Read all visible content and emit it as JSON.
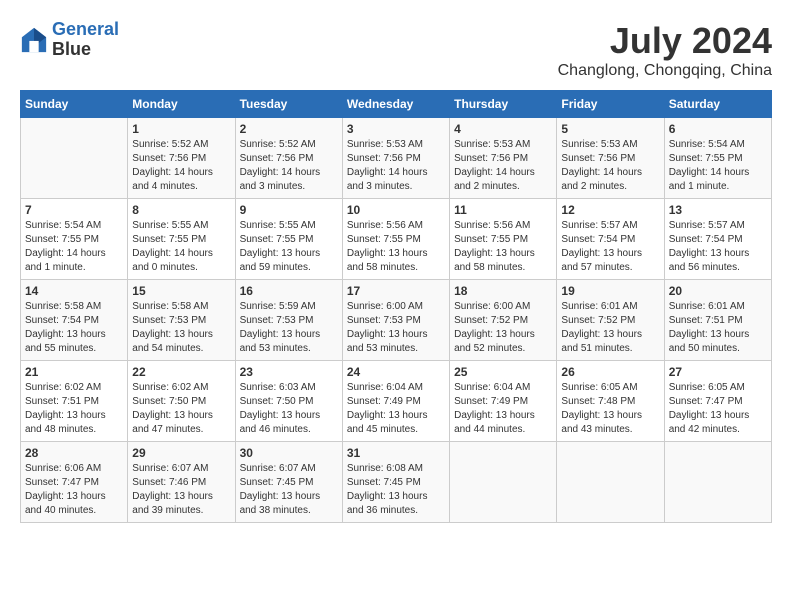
{
  "header": {
    "logo_line1": "General",
    "logo_line2": "Blue",
    "month_year": "July 2024",
    "location": "Changlong, Chongqing, China"
  },
  "weekdays": [
    "Sunday",
    "Monday",
    "Tuesday",
    "Wednesday",
    "Thursday",
    "Friday",
    "Saturday"
  ],
  "weeks": [
    [
      {
        "day": "",
        "sunrise": "",
        "sunset": "",
        "daylight": ""
      },
      {
        "day": "1",
        "sunrise": "Sunrise: 5:52 AM",
        "sunset": "Sunset: 7:56 PM",
        "daylight": "Daylight: 14 hours and 4 minutes."
      },
      {
        "day": "2",
        "sunrise": "Sunrise: 5:52 AM",
        "sunset": "Sunset: 7:56 PM",
        "daylight": "Daylight: 14 hours and 3 minutes."
      },
      {
        "day": "3",
        "sunrise": "Sunrise: 5:53 AM",
        "sunset": "Sunset: 7:56 PM",
        "daylight": "Daylight: 14 hours and 3 minutes."
      },
      {
        "day": "4",
        "sunrise": "Sunrise: 5:53 AM",
        "sunset": "Sunset: 7:56 PM",
        "daylight": "Daylight: 14 hours and 2 minutes."
      },
      {
        "day": "5",
        "sunrise": "Sunrise: 5:53 AM",
        "sunset": "Sunset: 7:56 PM",
        "daylight": "Daylight: 14 hours and 2 minutes."
      },
      {
        "day": "6",
        "sunrise": "Sunrise: 5:54 AM",
        "sunset": "Sunset: 7:55 PM",
        "daylight": "Daylight: 14 hours and 1 minute."
      }
    ],
    [
      {
        "day": "7",
        "sunrise": "Sunrise: 5:54 AM",
        "sunset": "Sunset: 7:55 PM",
        "daylight": "Daylight: 14 hours and 1 minute."
      },
      {
        "day": "8",
        "sunrise": "Sunrise: 5:55 AM",
        "sunset": "Sunset: 7:55 PM",
        "daylight": "Daylight: 14 hours and 0 minutes."
      },
      {
        "day": "9",
        "sunrise": "Sunrise: 5:55 AM",
        "sunset": "Sunset: 7:55 PM",
        "daylight": "Daylight: 13 hours and 59 minutes."
      },
      {
        "day": "10",
        "sunrise": "Sunrise: 5:56 AM",
        "sunset": "Sunset: 7:55 PM",
        "daylight": "Daylight: 13 hours and 58 minutes."
      },
      {
        "day": "11",
        "sunrise": "Sunrise: 5:56 AM",
        "sunset": "Sunset: 7:55 PM",
        "daylight": "Daylight: 13 hours and 58 minutes."
      },
      {
        "day": "12",
        "sunrise": "Sunrise: 5:57 AM",
        "sunset": "Sunset: 7:54 PM",
        "daylight": "Daylight: 13 hours and 57 minutes."
      },
      {
        "day": "13",
        "sunrise": "Sunrise: 5:57 AM",
        "sunset": "Sunset: 7:54 PM",
        "daylight": "Daylight: 13 hours and 56 minutes."
      }
    ],
    [
      {
        "day": "14",
        "sunrise": "Sunrise: 5:58 AM",
        "sunset": "Sunset: 7:54 PM",
        "daylight": "Daylight: 13 hours and 55 minutes."
      },
      {
        "day": "15",
        "sunrise": "Sunrise: 5:58 AM",
        "sunset": "Sunset: 7:53 PM",
        "daylight": "Daylight: 13 hours and 54 minutes."
      },
      {
        "day": "16",
        "sunrise": "Sunrise: 5:59 AM",
        "sunset": "Sunset: 7:53 PM",
        "daylight": "Daylight: 13 hours and 53 minutes."
      },
      {
        "day": "17",
        "sunrise": "Sunrise: 6:00 AM",
        "sunset": "Sunset: 7:53 PM",
        "daylight": "Daylight: 13 hours and 53 minutes."
      },
      {
        "day": "18",
        "sunrise": "Sunrise: 6:00 AM",
        "sunset": "Sunset: 7:52 PM",
        "daylight": "Daylight: 13 hours and 52 minutes."
      },
      {
        "day": "19",
        "sunrise": "Sunrise: 6:01 AM",
        "sunset": "Sunset: 7:52 PM",
        "daylight": "Daylight: 13 hours and 51 minutes."
      },
      {
        "day": "20",
        "sunrise": "Sunrise: 6:01 AM",
        "sunset": "Sunset: 7:51 PM",
        "daylight": "Daylight: 13 hours and 50 minutes."
      }
    ],
    [
      {
        "day": "21",
        "sunrise": "Sunrise: 6:02 AM",
        "sunset": "Sunset: 7:51 PM",
        "daylight": "Daylight: 13 hours and 48 minutes."
      },
      {
        "day": "22",
        "sunrise": "Sunrise: 6:02 AM",
        "sunset": "Sunset: 7:50 PM",
        "daylight": "Daylight: 13 hours and 47 minutes."
      },
      {
        "day": "23",
        "sunrise": "Sunrise: 6:03 AM",
        "sunset": "Sunset: 7:50 PM",
        "daylight": "Daylight: 13 hours and 46 minutes."
      },
      {
        "day": "24",
        "sunrise": "Sunrise: 6:04 AM",
        "sunset": "Sunset: 7:49 PM",
        "daylight": "Daylight: 13 hours and 45 minutes."
      },
      {
        "day": "25",
        "sunrise": "Sunrise: 6:04 AM",
        "sunset": "Sunset: 7:49 PM",
        "daylight": "Daylight: 13 hours and 44 minutes."
      },
      {
        "day": "26",
        "sunrise": "Sunrise: 6:05 AM",
        "sunset": "Sunset: 7:48 PM",
        "daylight": "Daylight: 13 hours and 43 minutes."
      },
      {
        "day": "27",
        "sunrise": "Sunrise: 6:05 AM",
        "sunset": "Sunset: 7:47 PM",
        "daylight": "Daylight: 13 hours and 42 minutes."
      }
    ],
    [
      {
        "day": "28",
        "sunrise": "Sunrise: 6:06 AM",
        "sunset": "Sunset: 7:47 PM",
        "daylight": "Daylight: 13 hours and 40 minutes."
      },
      {
        "day": "29",
        "sunrise": "Sunrise: 6:07 AM",
        "sunset": "Sunset: 7:46 PM",
        "daylight": "Daylight: 13 hours and 39 minutes."
      },
      {
        "day": "30",
        "sunrise": "Sunrise: 6:07 AM",
        "sunset": "Sunset: 7:45 PM",
        "daylight": "Daylight: 13 hours and 38 minutes."
      },
      {
        "day": "31",
        "sunrise": "Sunrise: 6:08 AM",
        "sunset": "Sunset: 7:45 PM",
        "daylight": "Daylight: 13 hours and 36 minutes."
      },
      {
        "day": "",
        "sunrise": "",
        "sunset": "",
        "daylight": ""
      },
      {
        "day": "",
        "sunrise": "",
        "sunset": "",
        "daylight": ""
      },
      {
        "day": "",
        "sunrise": "",
        "sunset": "",
        "daylight": ""
      }
    ]
  ]
}
